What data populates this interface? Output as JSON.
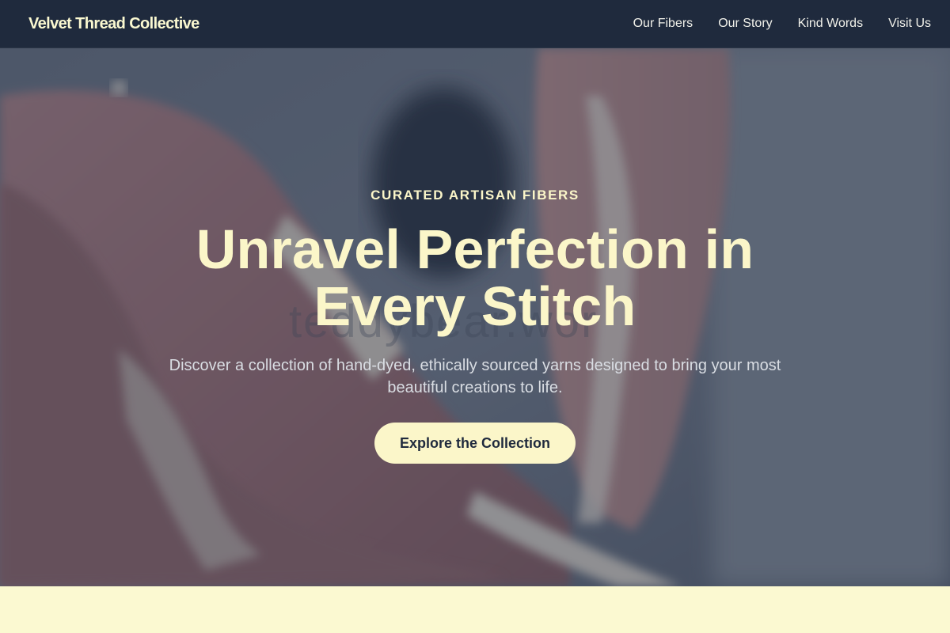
{
  "nav": {
    "brand": "Velvet Thread Collective",
    "links": [
      "Our Fibers",
      "Our Story",
      "Kind Words",
      "Visit Us"
    ]
  },
  "hero": {
    "eyebrow": "CURATED ARTISAN FIBERS",
    "headline": "Unravel Perfection in Every Stitch",
    "subtext": "Discover a collection of hand-dyed, ethically sourced yarns designed to bring your most beautiful creations to life.",
    "cta_label": "Explore the Collection",
    "background_image": "hands-kneading-clay-photo",
    "watermark": "teddybear.wor"
  },
  "colors": {
    "nav_bg": "#1f2a3d",
    "accent_cream": "#fbf6c9",
    "page_bg": "#fbf9d1"
  }
}
